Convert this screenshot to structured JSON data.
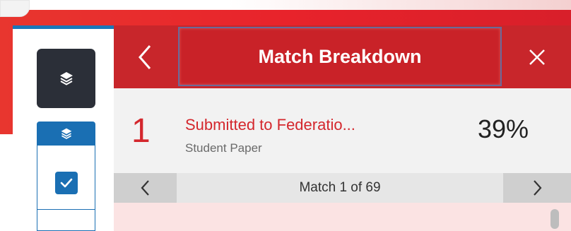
{
  "header": {
    "title": "Match Breakdown",
    "back_icon": "chevron-left-icon",
    "close_icon": "close-icon"
  },
  "toolbar": {
    "layers_icon": "layers-icon",
    "filter_icon": "layers-icon",
    "checkbox_checked": true
  },
  "match": {
    "number": "1",
    "source": "Submitted to Federatio...",
    "type": "Student Paper",
    "percent": "39%"
  },
  "nav": {
    "label": "Match 1 of 69"
  },
  "banner": {
    "glyph": ")"
  },
  "colors": {
    "brand_red": "#c8262b",
    "match_red": "#d4272d",
    "toolbar_blue": "#1a6fb3",
    "highlight": "#fbe3e3"
  }
}
